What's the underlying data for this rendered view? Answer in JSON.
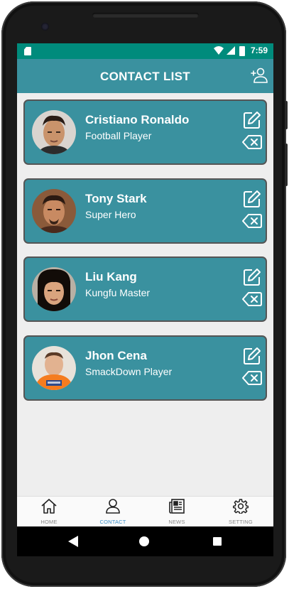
{
  "statusbar": {
    "time": "7:59"
  },
  "appbar": {
    "title": "CONTACT LIST"
  },
  "contacts": [
    {
      "name": "Cristiano Ronaldo",
      "role": "Football Player"
    },
    {
      "name": "Tony Stark",
      "role": "Super Hero"
    },
    {
      "name": "Liu Kang",
      "role": "Kungfu Master"
    },
    {
      "name": "Jhon Cena",
      "role": "SmackDown Player"
    }
  ],
  "bottom_nav": [
    {
      "label": "HOME",
      "icon": "home-icon"
    },
    {
      "label": "CONTACT",
      "icon": "person-icon"
    },
    {
      "label": "NEWS",
      "icon": "news-icon"
    },
    {
      "label": "SETTING",
      "icon": "gear-icon"
    }
  ],
  "colors": {
    "status_bar": "#008b7c",
    "primary": "#3a919f",
    "background": "#eeeeee",
    "active_nav": "#3c8fc8"
  }
}
